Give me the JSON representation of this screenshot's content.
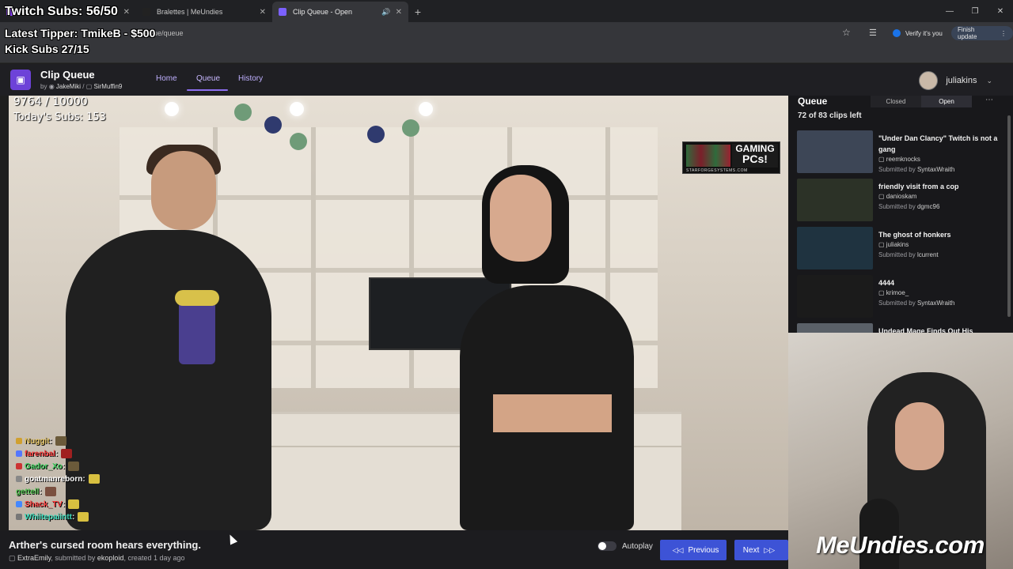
{
  "browser": {
    "tabs": [
      {
        "label": "",
        "favicon_color": "#9146ff",
        "active": false
      },
      {
        "label": "Bralettes | MeUndies",
        "favicon_color": "#222222",
        "active": false
      },
      {
        "label": "Clip Queue - Open",
        "favicon_color": "#7b61ff",
        "active": true
      }
    ],
    "url": "-queue/queue",
    "verify_label": "Verify it's you",
    "finish_label": "Finish update"
  },
  "overlay": {
    "twitch_subs": "Twitch Subs: 56/50",
    "latest_tipper": "Latest Tipper: TmikeB - $500",
    "kick_subs": "Kick Subs 27/15",
    "counter": "9764 / 10000",
    "todays_subs": "Today's Subs: 153"
  },
  "app": {
    "title": "Clip Queue",
    "by": "by",
    "author1": "JakeMiki",
    "separator": "/",
    "author2": "SirMuffin9",
    "nav": [
      "Home",
      "Queue",
      "History"
    ],
    "user": "juliakins"
  },
  "ad": {
    "headline1": "GAMING",
    "headline2": "PCs!",
    "url": "STARFORGESYSTEMS.COM"
  },
  "chat": [
    {
      "name": "Nuggit",
      "color": "#e0c060"
    },
    {
      "name": "farenbal",
      "color": "#ff4040"
    },
    {
      "name": "Gador_Xo",
      "color": "#40d060"
    },
    {
      "name": "goatmanreborn",
      "color": "#ffffff"
    },
    {
      "name": "gettell",
      "color": "#50c050"
    },
    {
      "name": "Shack_TV",
      "color": "#ff4040"
    },
    {
      "name": "Whiitepaiintt",
      "color": "#40e0c0"
    }
  ],
  "clip": {
    "title": "Arther's cursed room hears everything.",
    "channel": "ExtraEmily",
    "submitted_text": ", submitted by",
    "submitter": "ekoploid",
    "created_text": ", created 1 day ago"
  },
  "controls": {
    "autoplay": "Autoplay",
    "previous": "Previous",
    "next": "Next"
  },
  "queue": {
    "title": "Queue",
    "closed": "Closed",
    "open": "Open",
    "clips_left": "72 of 83 clips left",
    "items": [
      {
        "title": "\"Under Dan Clancy\" Twitch is not a gang",
        "channel": "reemknocks",
        "submitted_by": "Submitted by",
        "submitter": "SyntaxWraith",
        "thumb_color": "#3d4656"
      },
      {
        "title": "friendly visit from a cop",
        "channel": "danioskam",
        "submitted_by": "Submitted by",
        "submitter": "dgmc96",
        "thumb_color": "#2c3227"
      },
      {
        "title": "The ghost of honkers",
        "channel": "juliakins",
        "submitted_by": "Submitted by",
        "submitter": "lcurrent",
        "thumb_color": "#1f3340"
      },
      {
        "title": "4444",
        "channel": "krimoe_",
        "submitted_by": "Submitted by",
        "submitter": "SyntaxWraith",
        "thumb_color": "#1b1b1b"
      },
      {
        "title": "Undead Mage Finds Out His",
        "channel": "",
        "submitted_by": "",
        "submitter": "",
        "thumb_color": "#5a6068"
      }
    ]
  },
  "brand": "MeUndies.com",
  "colors": {
    "accent": "#3d53d6",
    "logo": "#6d42d8"
  }
}
